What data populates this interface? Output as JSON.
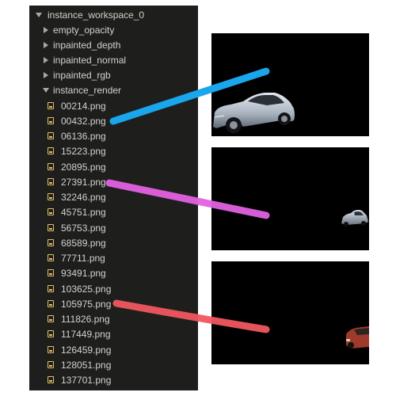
{
  "tree": {
    "root": "instance_workspace_0",
    "folders": [
      "empty_opacity",
      "inpainted_depth",
      "inpainted_normal",
      "inpainted_rgb"
    ],
    "open_folder": "instance_render",
    "files": [
      "00214.png",
      "00432.png",
      "06136.png",
      "15223.png",
      "20895.png",
      "27391.png",
      "32246.png",
      "45751.png",
      "56753.png",
      "68589.png",
      "77711.png",
      "93491.png",
      "103625.png",
      "105975.png",
      "111826.png",
      "117449.png",
      "126459.png",
      "128051.png",
      "137701.png"
    ]
  },
  "previews": [
    {
      "file": "00432.png",
      "car": "silver-sedan",
      "stroke_color": "#1aa6ec"
    },
    {
      "file": "27391.png",
      "car": "silver-sedan-small",
      "stroke_color": "#e261e2"
    },
    {
      "file": "105975.png",
      "car": "red-car-partial",
      "stroke_color": "#f0575f"
    }
  ],
  "colors": {
    "panel": "#1e1f1c",
    "text": "#d2d2cc",
    "file_icon": "#e2c06a"
  }
}
